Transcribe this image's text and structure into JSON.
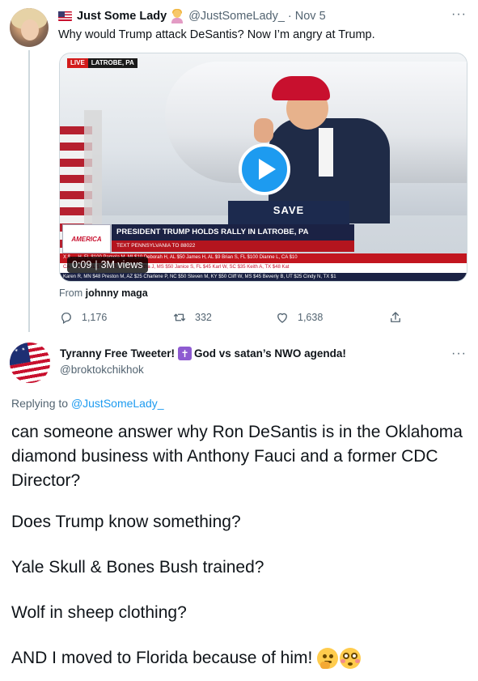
{
  "tweet1": {
    "name": "Just Some Lady",
    "handle": "@JustSomeLady_",
    "dot": "·",
    "date": "Nov 5",
    "more": "···",
    "text": "Why would Trump attack DeSantis? Now I’m angry at Trump.",
    "video": {
      "live_label": "LIVE",
      "location": "LATROBE, PA",
      "podium_text": "SAVE",
      "network_logo": "AMERICA",
      "headline": "PRESIDENT TRUMP HOLDS RALLY IN LATROBE, PA",
      "subline": "TEXT PENNSYLVANIA TO 88022",
      "ticker_red": "X $  …  H, FL $100   Pamela M, MI $10   Deborah H, AL $50   James H, AL $9   Brian S, FL $100   Dianne L, CA $10",
      "ticker_mid": "CA  …  dell P, IL $7   Gail R, ID $50   Martha J, MS $50   Janice S, FL $45   Karl W, SC $35   Keith A, TX $48   Kat",
      "ticker_dark": "Karen R, MN $48   Preston M, AZ $25   Charlene P, NC $50   Steven M, KY $50   Cliff W, MS $45   Beverly B, UT $25   Cindy N, TX $1",
      "duration": "0:09",
      "separator": "|",
      "views": "3M views"
    },
    "from_label": "From",
    "from_user": "johnny maga",
    "actions": {
      "replies": "1,176",
      "retweets": "332",
      "likes": "1,638"
    }
  },
  "tweet2": {
    "name": "Tyranny Free Tweeter!",
    "name_suffix": "God vs satan’s NWO agenda!",
    "cross_glyph": "✝",
    "handle": "@broktokchikhok",
    "more": "···",
    "replying_label": "Replying to",
    "replying_to": "@JustSomeLady_",
    "paragraphs": [
      "can someone answer why Ron DeSantis is in the Oklahoma diamond business with Anthony Fauci and a former CDC Director?",
      "Does Trump know something?",
      "Yale Skull & Bones Bush trained?",
      "Wolf in sheep clothing?",
      "AND I moved to Florida because of him!"
    ]
  },
  "colors": {
    "accent": "#1d9bf0",
    "secondary_text": "#536471",
    "primary_text": "#0f1419"
  },
  "icons": [
    "reply-icon",
    "retweet-icon",
    "like-icon",
    "share-icon",
    "play-icon",
    "more-icon"
  ]
}
